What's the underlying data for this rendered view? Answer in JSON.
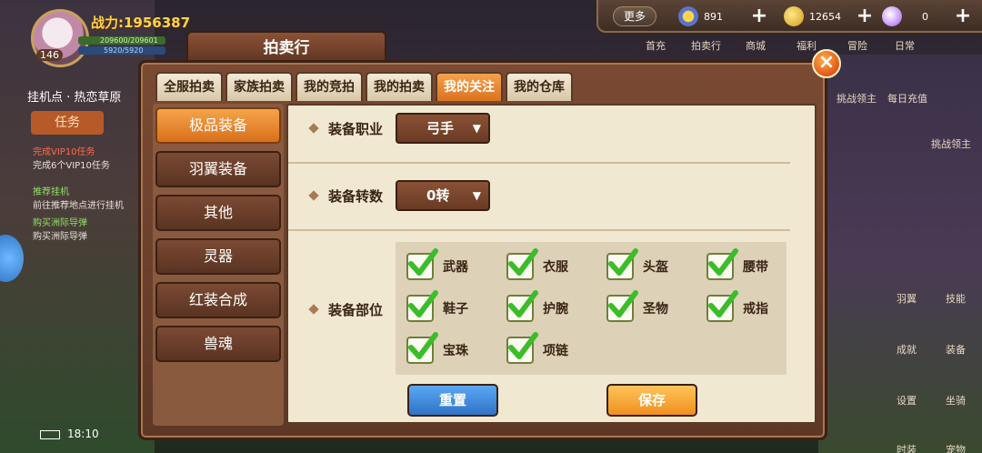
{
  "hud": {
    "level": "146",
    "power": "战力:1956387",
    "hp": "209600/209601",
    "mp": "5920/5920",
    "hang_point": "挂机点 · 热恋草原",
    "task_tab": "任务",
    "tasks": [
      {
        "title": "完成VIP10任务",
        "desc": "完成6个VIP10任务"
      },
      {
        "title": "推荐挂机",
        "desc": "前往推荐地点进行挂机"
      },
      {
        "title": "购买洲际导弹",
        "desc": "购买洲际导弹"
      }
    ],
    "time": "18:10"
  },
  "topbar": {
    "more": "更多",
    "medal": "891",
    "coin": "12654",
    "gem": "0"
  },
  "top_icons": [
    "首充",
    "拍卖行",
    "商城",
    "福利",
    "冒险",
    "日常"
  ],
  "right_icons": [
    "挑战领主",
    "每日充值",
    "挑战领主",
    "羽翼",
    "技能",
    "成就",
    "装备",
    "设置",
    "坐骑",
    "时装",
    "宠物"
  ],
  "modal": {
    "title": "拍卖行",
    "close": "×",
    "tabs": [
      "全服拍卖",
      "家族拍卖",
      "我的竞拍",
      "我的拍卖",
      "我的关注",
      "我的仓库"
    ],
    "active_tab": 4,
    "categories": [
      "极品装备",
      "羽翼装备",
      "其他",
      "灵器",
      "红装合成",
      "兽魂"
    ],
    "active_category": 0,
    "filters": {
      "job_label": "装备职业",
      "job_value": "弓手",
      "rebirth_label": "装备转数",
      "rebirth_value": "0转",
      "parts_label": "装备部位",
      "parts": [
        {
          "name": "武器",
          "checked": true
        },
        {
          "name": "衣服",
          "checked": true
        },
        {
          "name": "头盔",
          "checked": true
        },
        {
          "name": "腰带",
          "checked": true
        },
        {
          "name": "鞋子",
          "checked": true
        },
        {
          "name": "护腕",
          "checked": true
        },
        {
          "name": "圣物",
          "checked": true
        },
        {
          "name": "戒指",
          "checked": true
        },
        {
          "name": "宝珠",
          "checked": true
        },
        {
          "name": "项链",
          "checked": true
        }
      ]
    },
    "reset": "重置",
    "save": "保存"
  },
  "colors": {
    "accent_orange": "#d9731f",
    "reset_blue": "#2f73c6",
    "panel_bg": "#f1e8d2",
    "check_green": "#3bbd2a"
  }
}
